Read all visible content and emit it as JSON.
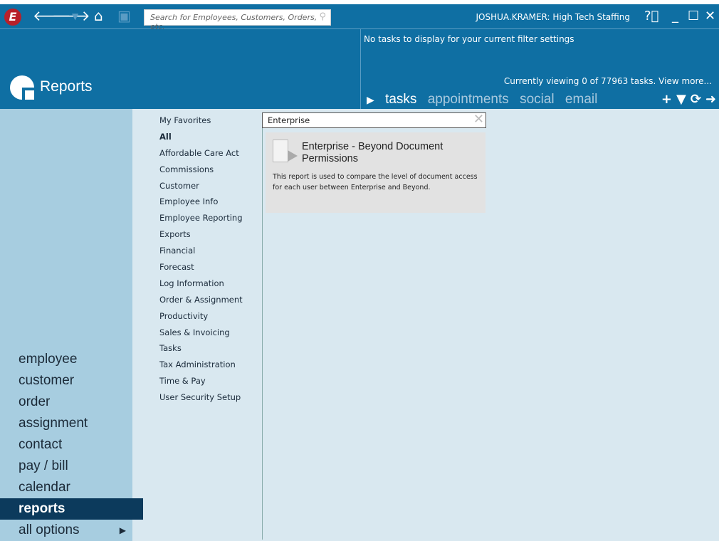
{
  "toolbar": {
    "logo": "E",
    "search_placeholder": "Search for Employees, Customers, Orders, etc.",
    "user": "JOSHUA.KRAMER: High Tech Staffing"
  },
  "page": {
    "title": "Reports"
  },
  "tasks": {
    "empty": "No tasks to display for your current filter settings",
    "viewing": "Currently viewing 0 of 77963 tasks. View more...",
    "tabs": [
      "tasks",
      "appointments",
      "social",
      "email"
    ]
  },
  "nav": [
    "employee",
    "customer",
    "order",
    "assignment",
    "contact",
    "pay / bill",
    "calendar",
    "reports",
    "all options"
  ],
  "categories": [
    "My Favorites",
    "All",
    "Affordable Care Act",
    "Commissions",
    "Customer",
    "Employee Info",
    "Employee Reporting",
    "Exports",
    "Financial",
    "Forecast",
    "Log Information",
    "Order & Assignment",
    "Productivity",
    "Sales & Invoicing",
    "Tasks",
    "Tax Administration",
    "Time & Pay",
    "User Security Setup"
  ],
  "filter": {
    "value": "Enterprise"
  },
  "report": {
    "title": "Enterprise - Beyond Document Permissions",
    "description": "This report is used to compare the level of document access for each user between Enterprise and Beyond."
  }
}
